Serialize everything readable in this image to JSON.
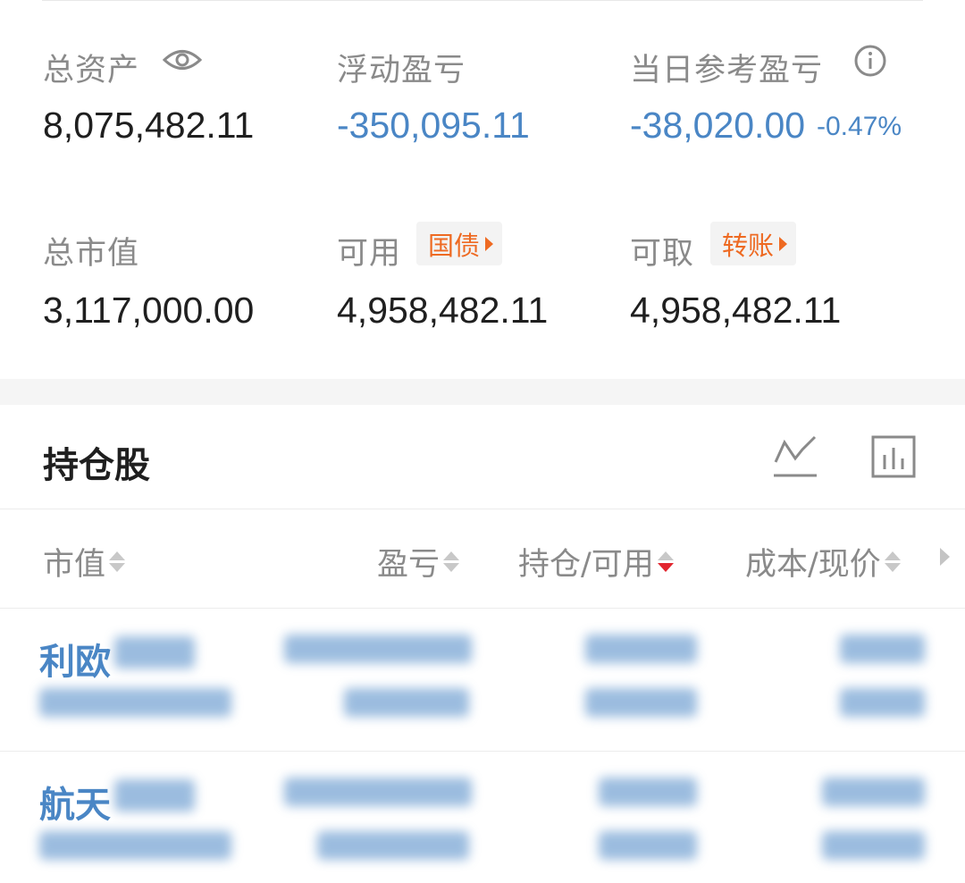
{
  "summary": {
    "total_assets": {
      "label": "总资产",
      "value": "8,075,482.11"
    },
    "floating_pnl": {
      "label": "浮动盈亏",
      "value": "-350,095.11"
    },
    "daily_pnl": {
      "label": "当日参考盈亏",
      "value": "-38,020.00",
      "percent": "-0.47%"
    },
    "market_value": {
      "label": "总市值",
      "value": "3,117,000.00"
    },
    "available": {
      "label": "可用",
      "value": "4,958,482.11",
      "chip": "国债"
    },
    "withdrawable": {
      "label": "可取",
      "value": "4,958,482.11",
      "chip": "转账"
    }
  },
  "holdings": {
    "title": "持仓股",
    "columns": [
      "市值",
      "盈亏",
      "持仓/可用",
      "成本/现价"
    ],
    "sort_active_column": "持仓/可用",
    "rows": [
      {
        "name_visible": "利欧"
      },
      {
        "name_visible": "航天"
      }
    ]
  },
  "colors": {
    "accent_blue": "#4a86c5",
    "orange": "#ee6a22",
    "sort_active": "#e2262f"
  },
  "icons": [
    "eye-icon",
    "info-icon",
    "line-chart-icon",
    "bar-chart-icon",
    "sort-icon",
    "chevron-right-icon"
  ]
}
